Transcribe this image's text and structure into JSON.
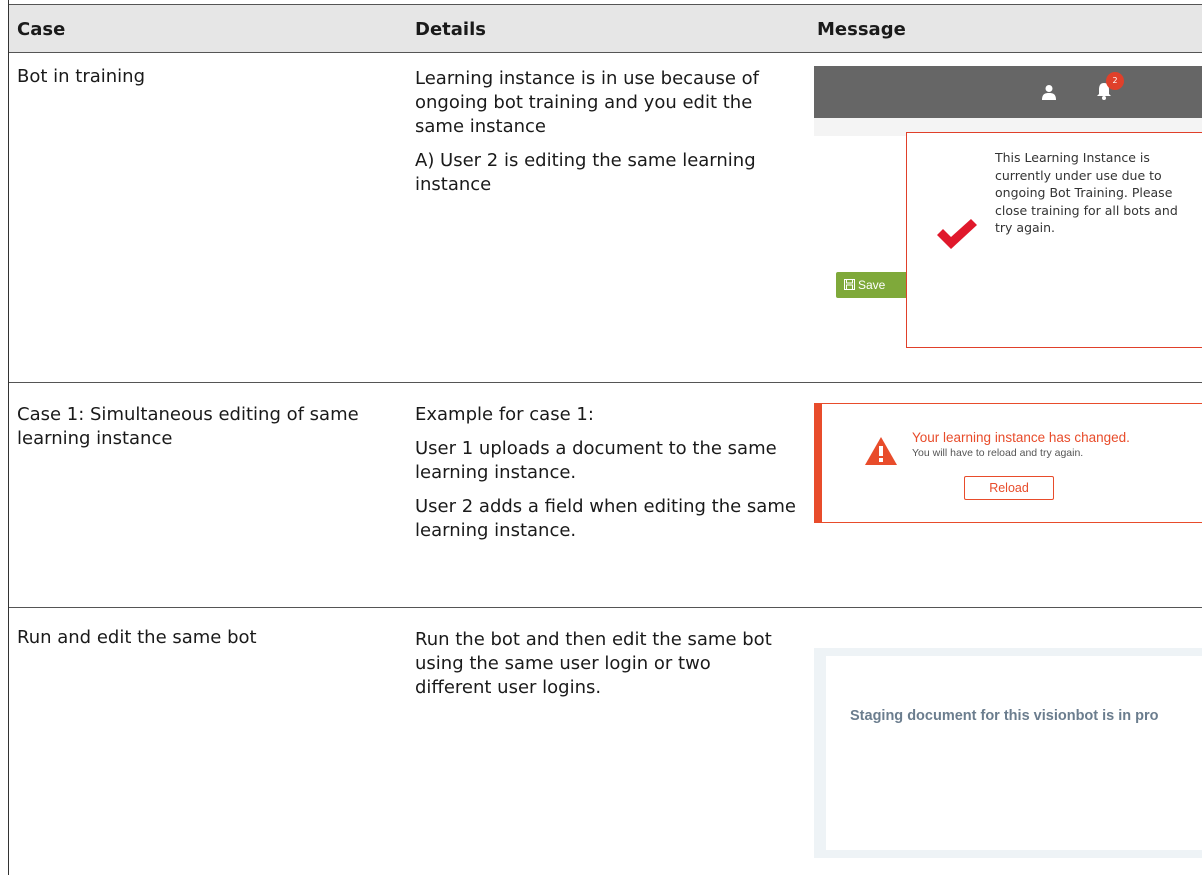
{
  "headers": {
    "case": "Case",
    "details": "Details",
    "message": "Message"
  },
  "rows": [
    {
      "case": "Bot in training",
      "details": [
        "Learning instance is in use because of ongoing bot training and you edit the same instance",
        "A) User 2 is editing the same learning instance"
      ],
      "message": {
        "badge_count": "2",
        "save_label": "Save",
        "dialog_text": "This Learning Instance is currently under use due to ongoing Bot Training. Please close training for all bots and try again."
      }
    },
    {
      "case": "Case 1: Simultaneous editing of same learning instance",
      "details": [
        "Example for case 1:",
        "User 1 uploads a document to the same learning instance.",
        "User 2 adds a field when editing the same learning instance."
      ],
      "message": {
        "title": "Your learning instance has changed.",
        "subtitle": "You will have to reload and try again.",
        "button": "Reload"
      }
    },
    {
      "case": "Run and edit the same bot",
      "details": [
        "Run the bot and then edit the same bot using the same user login or two different user logins."
      ],
      "message": {
        "text": "Staging document for this visionbot is in pro"
      }
    }
  ],
  "colors": {
    "header_bg": "#e6e6e6",
    "topbar": "#666666",
    "accent_red": "#e84c2b",
    "save_green": "#7fa93a",
    "staging_text": "#6b7d8e"
  },
  "icons": [
    "user-icon",
    "bell-icon",
    "check-icon",
    "save-icon",
    "warning-icon"
  ]
}
